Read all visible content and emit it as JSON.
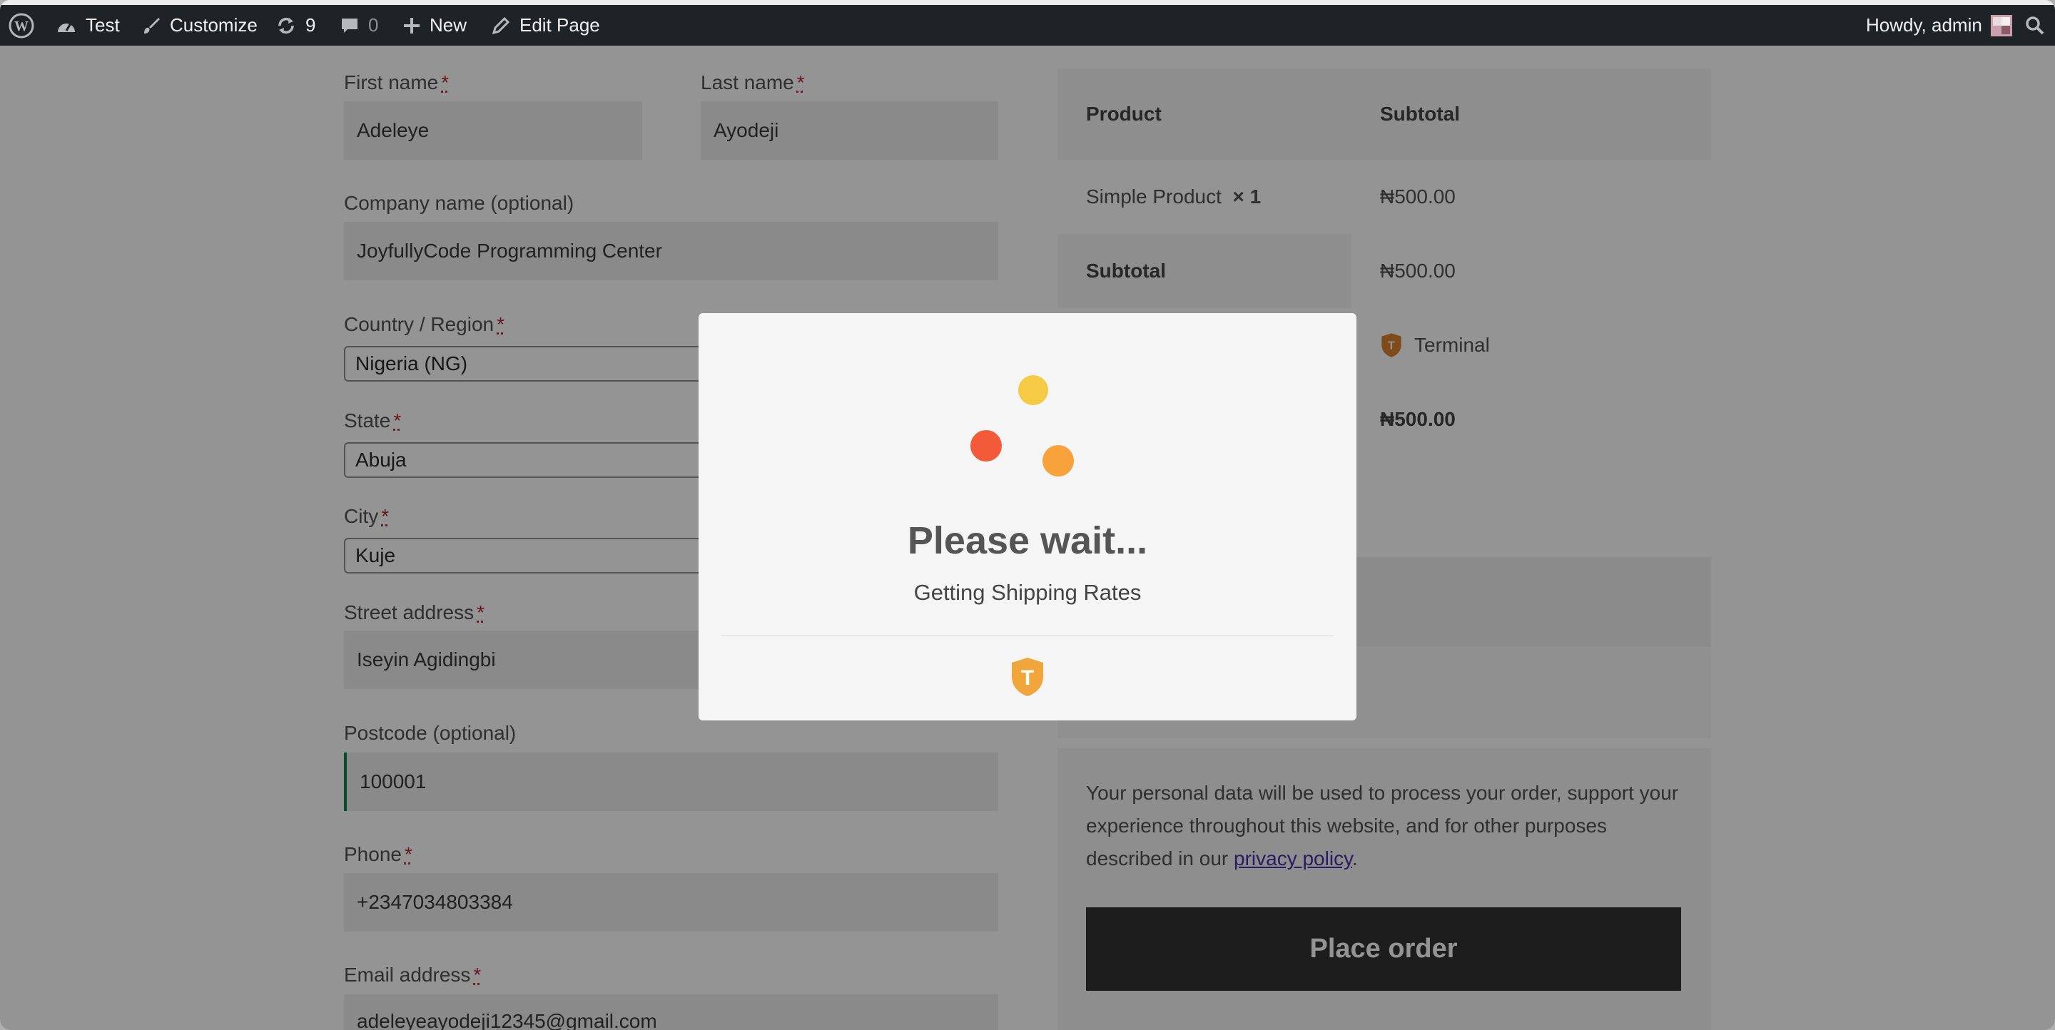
{
  "adminbar": {
    "site_name": "Test",
    "customize": "Customize",
    "updates_count": "9",
    "comments_count": "0",
    "new": "New",
    "edit_page": "Edit Page",
    "howdy": "Howdy, admin"
  },
  "form": {
    "first_name": {
      "label": "First name",
      "required": "*",
      "value": "Adeleye"
    },
    "last_name": {
      "label": "Last name",
      "required": "*",
      "value": "Ayodeji"
    },
    "company": {
      "label": "Company name (optional)",
      "value": "JoyfullyCode Programming Center"
    },
    "country": {
      "label": "Country / Region",
      "required": "*",
      "value": "Nigeria (NG)"
    },
    "state": {
      "label": "State",
      "required": "*",
      "value": "Abuja"
    },
    "city": {
      "label": "City",
      "required": "*",
      "value": "Kuje"
    },
    "street": {
      "label": "Street address",
      "required": "*",
      "value": "Iseyin Agidingbi"
    },
    "postcode": {
      "label": "Postcode (optional)",
      "value": "100001"
    },
    "phone": {
      "label": "Phone",
      "required": "*",
      "value": "+2347034803384"
    },
    "email": {
      "label": "Email address",
      "required": "*",
      "value": "adeleyeayodeji12345@gmail.com"
    }
  },
  "order": {
    "head_product": "Product",
    "head_subtotal": "Subtotal",
    "item_name": "Simple Product",
    "item_qty": "× 1",
    "item_price": "₦500.00",
    "subtotal_label": "Subtotal",
    "subtotal_value": "₦500.00",
    "shipping_value": "Terminal",
    "total_value": "₦500.00"
  },
  "privacy": {
    "text_before": "Your personal data will be used to process your order, support your experience throughout this website, and for other purposes described in our ",
    "link": "privacy policy",
    "text_after": "."
  },
  "place_order": "Place order",
  "modal": {
    "title": "Please wait...",
    "subtitle": "Getting Shipping Rates",
    "dot_colors": [
      "#f6ca45",
      "#f25a3a",
      "#f7a23b"
    ],
    "logo_color": "#f0a63a"
  }
}
